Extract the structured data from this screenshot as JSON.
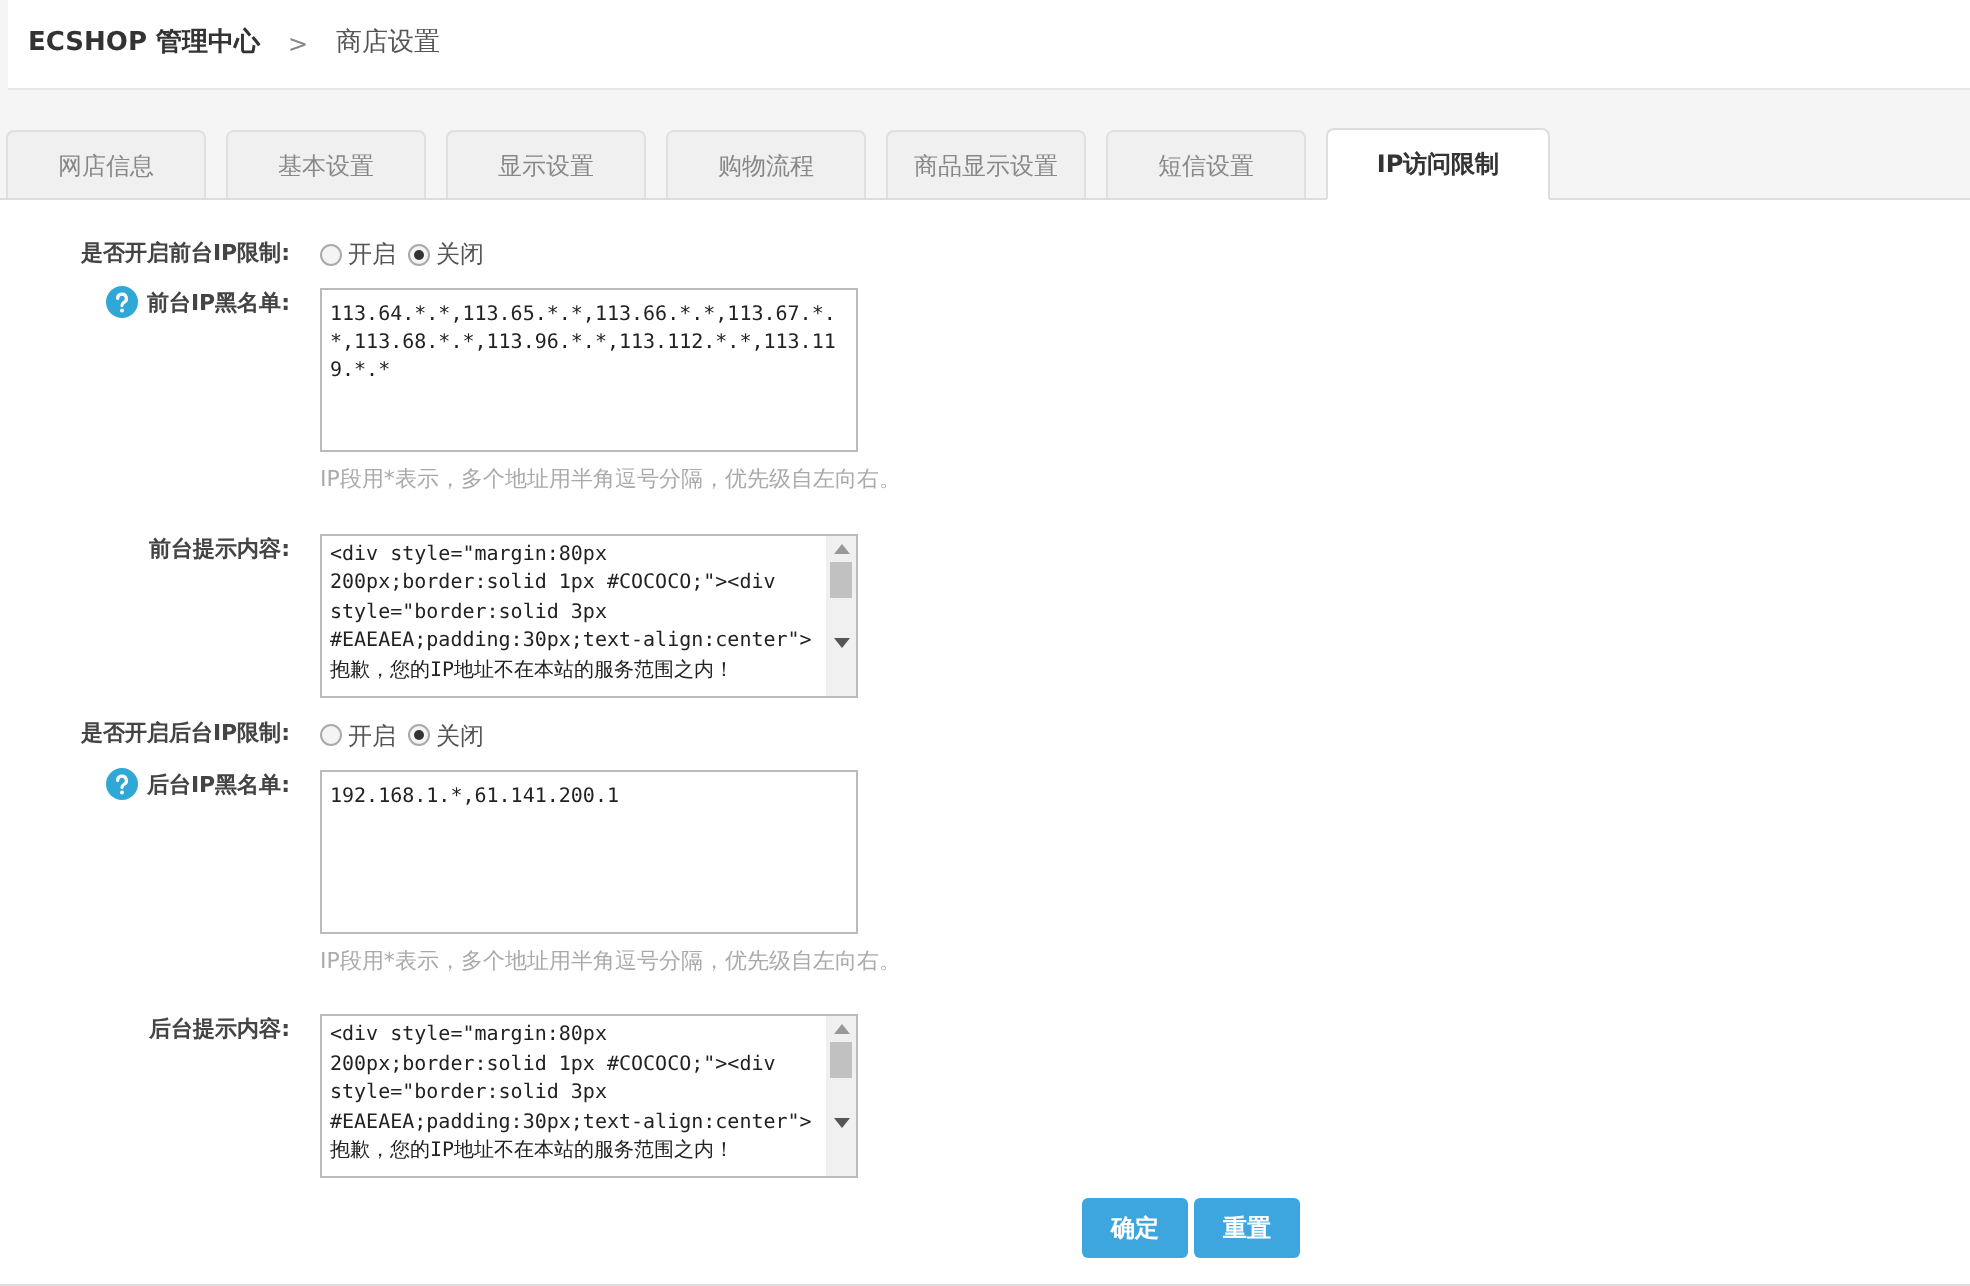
{
  "header": {
    "brand": "ECSHOP 管理中心",
    "separator": ">",
    "page": "商店设置"
  },
  "tabs": [
    {
      "label": "网店信息",
      "selected": false
    },
    {
      "label": "基本设置",
      "selected": false
    },
    {
      "label": "显示设置",
      "selected": false
    },
    {
      "label": "购物流程",
      "selected": false
    },
    {
      "label": "商品显示设置",
      "selected": false
    },
    {
      "label": "短信设置",
      "selected": false
    },
    {
      "label": "IP访问限制",
      "selected": true
    }
  ],
  "fields": [
    {
      "kind": "radio",
      "label": "是否开启前台IP限制:",
      "options": [
        {
          "label": "开启",
          "selected": false
        },
        {
          "label": "关闭",
          "selected": true
        }
      ]
    },
    {
      "kind": "textarea",
      "label": "前台IP黑名单:",
      "help": true,
      "value": "113.64.*.*,113.65.*.*,113.66.*.*,113.67.*.*,113.68.*.*,113.96.*.*,113.112.*.*,113.119.*.*",
      "hint": "IP段用*表示，多个地址用半角逗号分隔，优先级自左向右。"
    },
    {
      "kind": "scrolltext",
      "label": "前台提示内容:",
      "lines": [
        "<div style=\"margin:80px",
        "200px;border:solid 1px #COCOCO;\"><div",
        "style=\"border:solid 3px",
        "#EAEAEA;padding:30px;text-align:center\">",
        "抱歉，您的IP地址不在本站的服务范围之内！"
      ]
    },
    {
      "kind": "radio",
      "label": "是否开启后台IP限制:",
      "options": [
        {
          "label": "开启",
          "selected": false
        },
        {
          "label": "关闭",
          "selected": true
        }
      ]
    },
    {
      "kind": "textarea",
      "label": "后台IP黑名单:",
      "help": true,
      "value": "192.168.1.*,61.141.200.1",
      "hint": "IP段用*表示，多个地址用半角逗号分隔，优先级自左向右。"
    },
    {
      "kind": "scrolltext",
      "label": "后台提示内容:",
      "lines": [
        "<div style=\"margin:80px",
        "200px;border:solid 1px #COCOCO;\"><div",
        "style=\"border:solid 3px",
        "#EAEAEA;padding:30px;text-align:center\">",
        "抱歉，您的IP地址不在本站的服务范围之内！"
      ]
    }
  ],
  "buttons": [
    "确定",
    "重置"
  ]
}
